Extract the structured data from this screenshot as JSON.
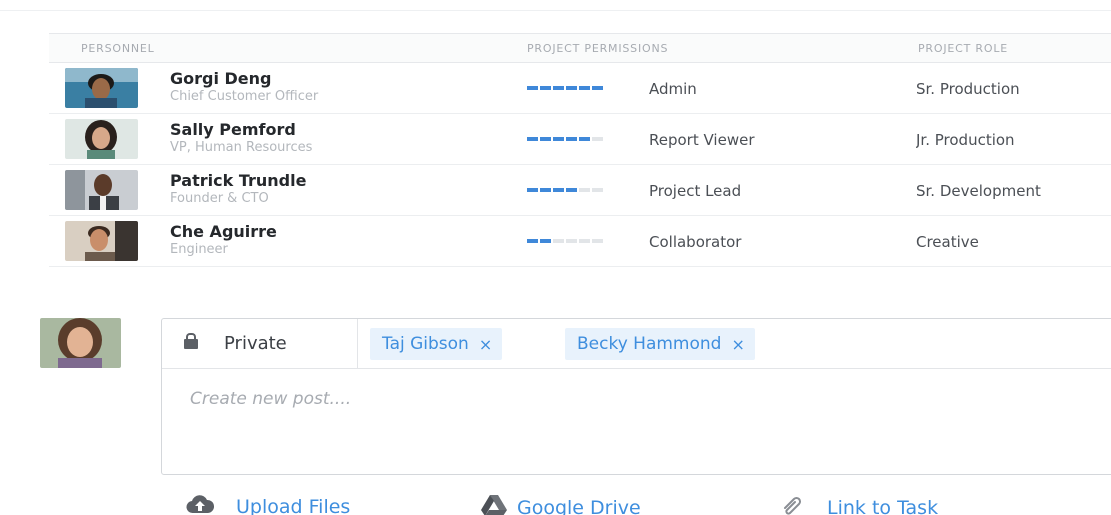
{
  "table": {
    "headers": {
      "personnel": "PERSONNEL",
      "permissions": "PROJECT  PERMISSIONS",
      "role": "PROJECT ROLE"
    },
    "rows": [
      {
        "name": "Gorgi Deng",
        "title": "Chief Customer Officer",
        "permission": "Admin",
        "permission_level": 6,
        "role": "Sr. Production"
      },
      {
        "name": "Sally Pemford",
        "title": "VP, Human Resources",
        "permission": "Report Viewer",
        "permission_level": 5,
        "role": "Jr. Production"
      },
      {
        "name": "Patrick Trundle",
        "title": "Founder & CTO",
        "permission": "Project Lead",
        "permission_level": 4,
        "role": "Sr. Development"
      },
      {
        "name": "Che Aguirre",
        "title": "Engineer",
        "permission": "Collaborator",
        "permission_level": 2,
        "role": "Creative"
      }
    ],
    "permission_max": 6
  },
  "composer": {
    "privacy_label": "Private",
    "recipients": [
      {
        "label": "Taj Gibson",
        "remove": "×"
      },
      {
        "label": "Becky Hammond",
        "remove": "×"
      }
    ],
    "placeholder": "Create new post...."
  },
  "actions": {
    "upload": "Upload Files",
    "drive": "Google Drive",
    "link": "Link to Task"
  },
  "colors": {
    "accent": "#3e8ede",
    "bar_on": "#3f88d9",
    "bar_off": "#e2e5e8",
    "chip_bg": "#e8f2fc"
  },
  "icons": {
    "privacy": "lock-icon",
    "upload": "cloud-upload-icon",
    "drive": "google-drive-icon",
    "link": "paperclip-icon"
  }
}
